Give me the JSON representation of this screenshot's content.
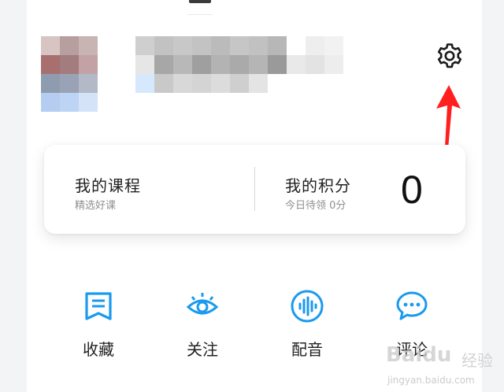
{
  "profile": {
    "avatar_mosaic": [
      "#d9c4c4",
      "#b89f9f",
      "#c9b4b4",
      "#ffffff",
      "#a7706e",
      "#a27c7e",
      "#c2a2a4",
      "#ffffff",
      "#8f9cb0",
      "#9aa3b6",
      "#b3b9c6",
      "#ffffff",
      "#b6cdf2",
      "#bdd4f5",
      "#d4e3f8",
      "#ffffff"
    ],
    "name_mosaic": [
      "#cfcfcf",
      "#c2c2c2",
      "#c8c8c8",
      "#c3c3c3",
      "#bbbbbb",
      "#c6c6c6",
      "#c1c1c1",
      "#b7b7b7",
      "#ffffff",
      "#eeeeee",
      "#f2f2f2",
      "#e6e6e6",
      "#a7a7a7",
      "#b8b8b8",
      "#9f9f9f",
      "#b3b3b3",
      "#aaaaaa",
      "#b5b5b5",
      "#9a9a9a",
      "#e9e9e9",
      "#e3e3e3",
      "#ededed",
      "#d6e8fb",
      "#c9c9c9",
      "#d8d8d8",
      "#d4d4d4",
      "#dcdcdc",
      "#cfcfcf",
      "#e4e4e4",
      "#ffffff",
      "#ffffff",
      "#ffffff",
      "#ffffff"
    ]
  },
  "settings_icon": "gear-icon",
  "annotation": {
    "arrow_color": "#ff1f1f"
  },
  "card": {
    "course": {
      "title": "我的课程",
      "subtitle": "精选好课"
    },
    "points": {
      "title": "我的积分",
      "subtitle": "今日待领 0分",
      "value": "0"
    }
  },
  "quick_actions": [
    {
      "label": "收藏",
      "icon": "bookmark-icon"
    },
    {
      "label": "关注",
      "icon": "eye-icon"
    },
    {
      "label": "配音",
      "icon": "voice-wave-icon"
    },
    {
      "label": "评论",
      "icon": "comment-bubble-icon"
    }
  ],
  "accent_color": "#1a9af0",
  "watermark": {
    "logo": "Baidu",
    "cn": "经验",
    "url": "jingyan.baidu.com"
  }
}
